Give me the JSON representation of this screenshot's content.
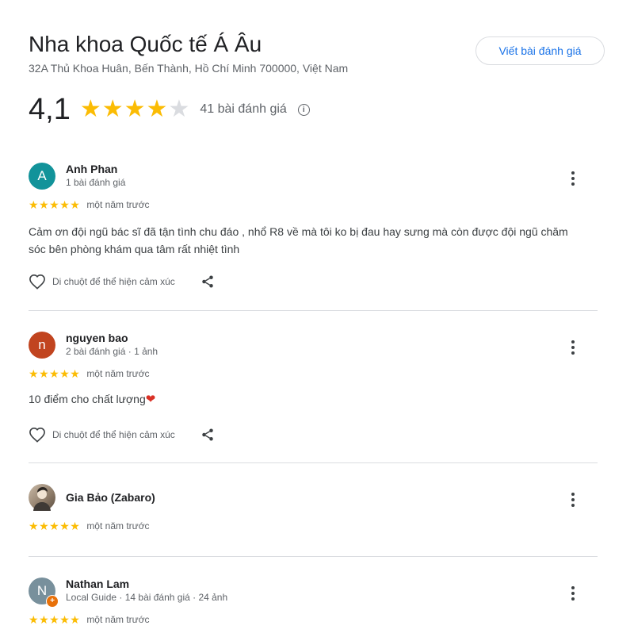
{
  "place": {
    "title": "Nha khoa Quốc tế Á Âu",
    "address": "32A Thủ Khoa Huân, Bến Thành, Hồ Chí Minh 700000, Việt Nam",
    "write_review_label": "Viết bài đánh giá"
  },
  "rating": {
    "value_text": "4,1",
    "stars_filled": 4,
    "stars_total": 5,
    "count_label": "41 bài đánh giá",
    "info_icon": "info-icon"
  },
  "colors": {
    "star": "#fbbc04",
    "star_empty": "#dadce0",
    "link_blue": "#1a73e8",
    "avatar_teal": "#12939a",
    "avatar_red": "#c1441f",
    "avatar_slate": "#78909c",
    "local_guide_orange": "#e8710a"
  },
  "reviews": [
    {
      "avatar_letter": "A",
      "name": "Anh Phan",
      "meta": "1 bài đánh giá",
      "stars": 5,
      "time": "một năm trước",
      "text": "Cảm ơn đội ngũ bác sĩ đã tận tình chu đáo , nhổ R8 về mà tôi ko bị đau hay sưng mà còn được đội ngũ chăm sóc bên phòng khám qua tâm rất nhiệt tình",
      "like_label": "Di chuột để thể hiện cảm xúc"
    },
    {
      "avatar_letter": "n",
      "name": "nguyen bao",
      "meta": "2 bài đánh giá · 1 ảnh",
      "stars": 5,
      "time": "một năm trước",
      "text": "10 điểm cho chất lượng",
      "text_emoji": "❤",
      "like_label": "Di chuột để thể hiện cảm xúc"
    },
    {
      "avatar_letter": "",
      "name": "Gia Bảo (Zabaro)",
      "meta": "",
      "stars": 5,
      "time": "một năm trước"
    },
    {
      "avatar_letter": "N",
      "name": "Nathan Lam",
      "meta": "Local Guide · 14 bài đánh giá · 24 ảnh",
      "stars": 5,
      "time": "một năm trước",
      "badge": "+"
    }
  ]
}
